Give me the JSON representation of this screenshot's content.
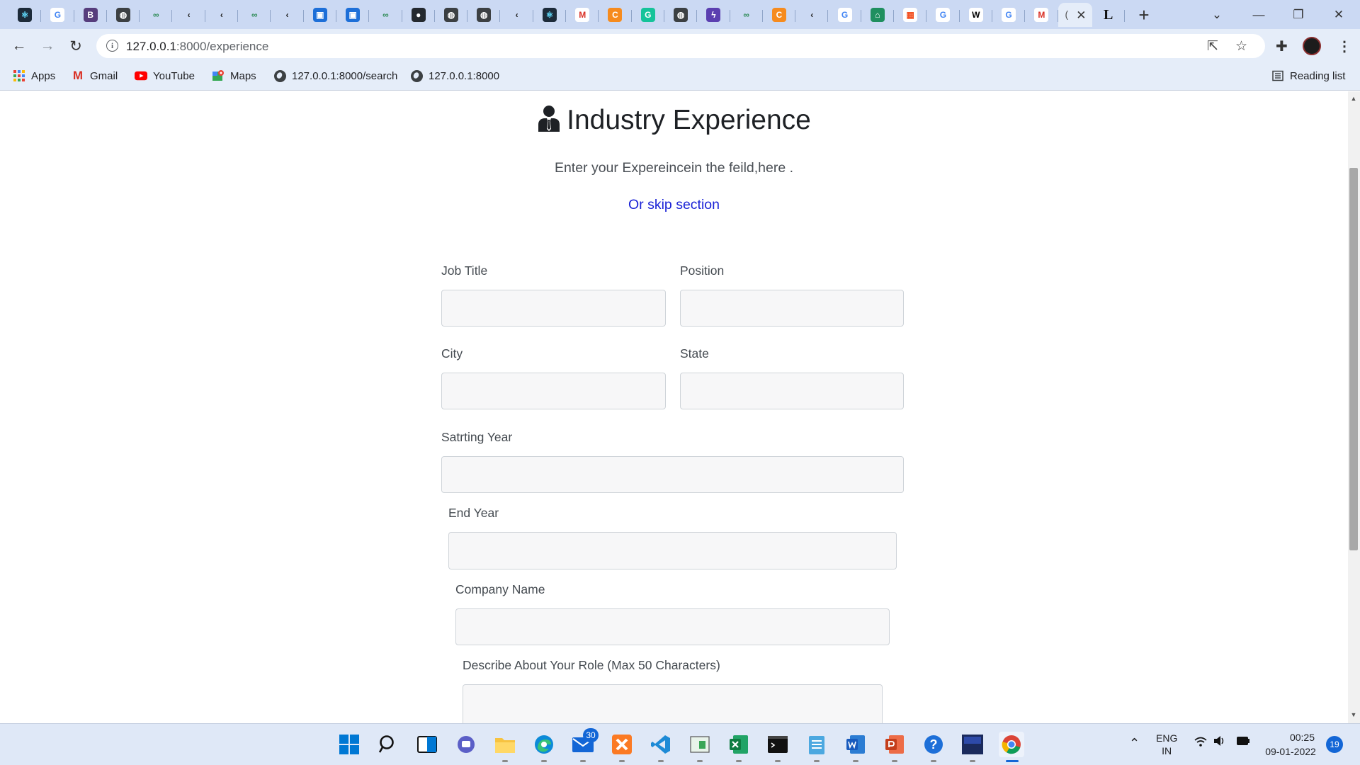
{
  "browser": {
    "active_tab_title": "(",
    "url_host": "127.0.0.1",
    "url_rest": ":8000/experience",
    "reading_list": "Reading list",
    "tab_icons": [
      {
        "name": "react-tab-icon",
        "bg": "#1d2b3a",
        "fg": "#61dafb",
        "glyph": "⚛"
      },
      {
        "name": "google-tab-icon",
        "bg": "#ffffff",
        "fg": "#4285f4",
        "glyph": "G"
      },
      {
        "name": "bootstrap-tab-icon",
        "bg": "#563d7c",
        "fg": "#ffffff",
        "glyph": "B"
      },
      {
        "name": "globe-tab-icon",
        "bg": "#3c4043",
        "fg": "#ffffff",
        "glyph": "◍"
      },
      {
        "name": "infinity-tab-icon",
        "bg": "#cbd9f3",
        "fg": "#2e8b57",
        "glyph": "∞"
      },
      {
        "name": "codepen-tab-icon",
        "bg": "#cbd9f3",
        "fg": "#222222",
        "glyph": "‹"
      },
      {
        "name": "codepen-tab-icon-2",
        "bg": "#cbd9f3",
        "fg": "#222222",
        "glyph": "‹"
      },
      {
        "name": "infinity-tab-icon-2",
        "bg": "#cbd9f3",
        "fg": "#2e8b57",
        "glyph": "∞"
      },
      {
        "name": "codepen-tab-icon-3",
        "bg": "#cbd9f3",
        "fg": "#222222",
        "glyph": "‹"
      },
      {
        "name": "cube-tab-icon",
        "bg": "#1d6fd8",
        "fg": "#ffffff",
        "glyph": "▣"
      },
      {
        "name": "cube-tab-icon-2",
        "bg": "#1d6fd8",
        "fg": "#ffffff",
        "glyph": "▣"
      },
      {
        "name": "infinity-tab-icon-3",
        "bg": "#cbd9f3",
        "fg": "#2e8b57",
        "glyph": "∞"
      },
      {
        "name": "github-tab-icon",
        "bg": "#24292f",
        "fg": "#ffffff",
        "glyph": "●"
      },
      {
        "name": "globe-tab-icon-2",
        "bg": "#3c4043",
        "fg": "#ffffff",
        "glyph": "◍"
      },
      {
        "name": "globe-tab-icon-3",
        "bg": "#3c4043",
        "fg": "#ffffff",
        "glyph": "◍"
      },
      {
        "name": "codepen-tab-icon-4",
        "bg": "#cbd9f3",
        "fg": "#222222",
        "glyph": "‹"
      },
      {
        "name": "react-tab-icon-2",
        "bg": "#1d2b3a",
        "fg": "#61dafb",
        "glyph": "⚛"
      },
      {
        "name": "gmail-tab-icon",
        "bg": "#ffffff",
        "fg": "#d93025",
        "glyph": "M"
      },
      {
        "name": "coursera-tab-icon",
        "bg": "#f68b1e",
        "fg": "#ffffff",
        "glyph": "C"
      },
      {
        "name": "grammarly-tab-icon",
        "bg": "#15c39a",
        "fg": "#ffffff",
        "glyph": "G"
      },
      {
        "name": "globe-tab-icon-4",
        "bg": "#3c4043",
        "fg": "#ffffff",
        "glyph": "◍"
      },
      {
        "name": "bolt-tab-icon",
        "bg": "#5b3fb0",
        "fg": "#ffffff",
        "glyph": "ϟ"
      },
      {
        "name": "infinity-tab-icon-4",
        "bg": "#cbd9f3",
        "fg": "#2e8b57",
        "glyph": "∞"
      },
      {
        "name": "coursera-tab-icon-2",
        "bg": "#f68b1e",
        "fg": "#ffffff",
        "glyph": "C"
      },
      {
        "name": "codepen-tab-icon-5",
        "bg": "#cbd9f3",
        "fg": "#222222",
        "glyph": "‹"
      },
      {
        "name": "google-tab-icon-2",
        "bg": "#ffffff",
        "fg": "#4285f4",
        "glyph": "G"
      },
      {
        "name": "home-tab-icon",
        "bg": "#1f8f5f",
        "fg": "#ffffff",
        "glyph": "⌂"
      },
      {
        "name": "microsoft-tab-icon",
        "bg": "#ffffff",
        "fg": "#f25022",
        "glyph": "▦"
      },
      {
        "name": "google-tab-icon-3",
        "bg": "#ffffff",
        "fg": "#4285f4",
        "glyph": "G"
      },
      {
        "name": "wikipedia-tab-icon",
        "bg": "#ffffff",
        "fg": "#000000",
        "glyph": "W"
      },
      {
        "name": "google-tab-icon-4",
        "bg": "#ffffff",
        "fg": "#4285f4",
        "glyph": "G"
      },
      {
        "name": "gmail-tab-icon-2",
        "bg": "#ffffff",
        "fg": "#d93025",
        "glyph": "M"
      }
    ],
    "bookmarks": {
      "apps": "Apps",
      "gmail": "Gmail",
      "youtube": "YouTube",
      "maps": "Maps",
      "search": "127.0.0.1:8000/search",
      "home": "127.0.0.1:8000"
    }
  },
  "page": {
    "title": "Industry Experience",
    "subtitle": "Enter your Expereincein the feild,here .",
    "skip_link": "Or skip section",
    "fields": {
      "job_title": "Job Title",
      "position": "Position",
      "city": "City",
      "state": "State",
      "starting_year": "Satrting Year",
      "end_year": "End Year",
      "company_name": "Company Name",
      "role_description": "Describe About Your Role (Max 50 Characters)"
    }
  },
  "taskbar": {
    "mail_badge": "30",
    "lang_line1": "ENG",
    "lang_line2": "IN",
    "time": "00:25",
    "date": "09-01-2022",
    "notifications": "19"
  },
  "colors": {
    "accent": "#1a22d6",
    "chrome_frame": "#cbd9f3",
    "toolbar": "#e5edf9"
  }
}
